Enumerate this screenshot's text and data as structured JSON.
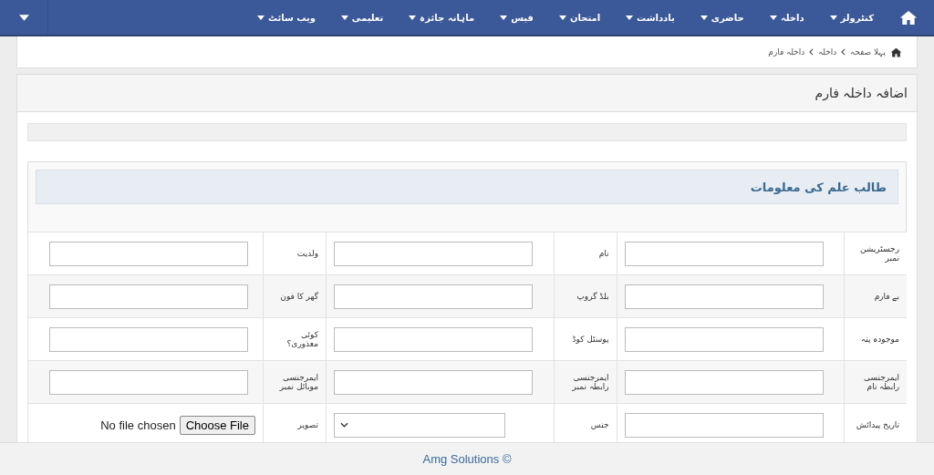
{
  "navbar": {
    "items": [
      {
        "label": "کنٹرولز"
      },
      {
        "label": "داخلہ"
      },
      {
        "label": "حاضری"
      },
      {
        "label": "یادداشت"
      },
      {
        "label": "امتحان"
      },
      {
        "label": "فیس"
      },
      {
        "label": "ماہانہ جائزہ"
      },
      {
        "label": "تعلیمی"
      },
      {
        "label": "ویب سائٹ"
      }
    ]
  },
  "breadcrumb": [
    "پہلا صفحہ",
    "داخلہ",
    "داخلہ فارم"
  ],
  "page_title": "اضافہ داخلہ فارم",
  "section_title": "طالب علم کی معلومات",
  "form_rows": [
    {
      "cells": [
        {
          "label": "رجسٹریشن نمبر",
          "kind": "text"
        },
        {
          "label": "نام",
          "kind": "text"
        },
        {
          "label": "ولدیت",
          "kind": "text"
        }
      ]
    },
    {
      "cells": [
        {
          "label": "بے فارم",
          "kind": "text"
        },
        {
          "label": "بلڈ گروپ",
          "kind": "text"
        },
        {
          "label": "گھر کا فون",
          "kind": "text"
        }
      ]
    },
    {
      "cells": [
        {
          "label": "موجودہ پتہ",
          "kind": "text"
        },
        {
          "label": "پوسٹل کوڈ",
          "kind": "text"
        },
        {
          "label": "کوئی معذوری؟",
          "kind": "text"
        }
      ]
    },
    {
      "cells": [
        {
          "label": "ایمرجنسی رابطہ نام",
          "kind": "text"
        },
        {
          "label": "ایمرجنسی رابطہ نمبر",
          "kind": "text"
        },
        {
          "label": "ایمرجنسی موبائل نمبر",
          "kind": "text"
        }
      ]
    },
    {
      "cells": [
        {
          "label": "تاریخ پیدائش",
          "kind": "text"
        },
        {
          "label": "جنس",
          "kind": "select"
        },
        {
          "label": "تصویر",
          "kind": "file",
          "button": "Choose File",
          "status": "No file chosen"
        }
      ]
    }
  ],
  "footer": "Amg Solutions ©"
}
